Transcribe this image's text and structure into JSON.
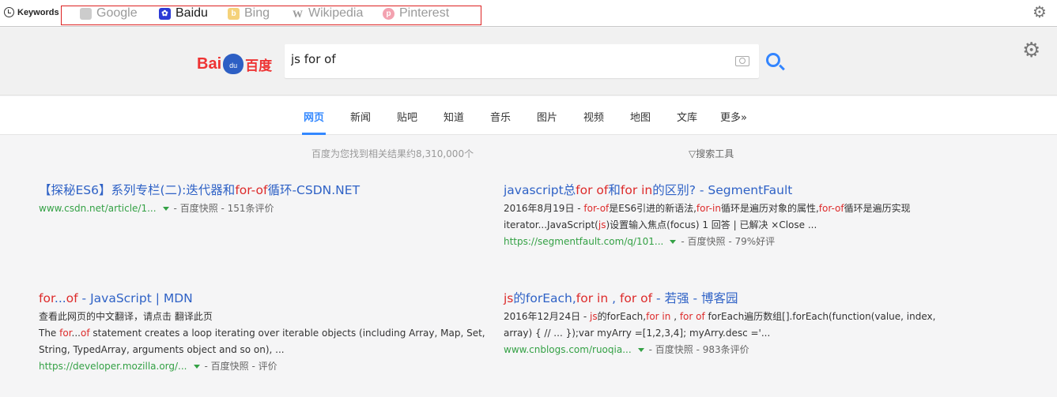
{
  "toolbar": {
    "keywords_label": "Keywords",
    "engines": [
      {
        "label": "Google",
        "icon": "google-icon",
        "color": "#bbbbbb"
      },
      {
        "label": "Baidu",
        "icon": "baidu-paw-icon",
        "color": "#2d3bd6"
      },
      {
        "label": "Bing",
        "icon": "bing-icon",
        "color": "#f5d27a"
      },
      {
        "label": "Wikipedia",
        "icon": "wikipedia-icon",
        "color": "#aaaaaa"
      },
      {
        "label": "Pinterest",
        "icon": "pinterest-icon",
        "color": "#f3a2b0"
      }
    ]
  },
  "header": {
    "logo": {
      "bai": "Bai",
      "du": "du",
      "cn": "百度"
    },
    "search_value": "js for of"
  },
  "tabs": [
    "网页",
    "新闻",
    "贴吧",
    "知道",
    "音乐",
    "图片",
    "视频",
    "地图",
    "文库",
    "更多»"
  ],
  "stats": "百度为您找到相关结果约8,310,000个",
  "tools": "▽搜索工具",
  "results": [
    {
      "title": [
        [
          "【探秘ES6】系列专栏(二):迭代器和",
          ""
        ],
        [
          "for-of",
          "red"
        ],
        [
          "循环-CSDN.NET",
          ""
        ]
      ],
      "url": "www.csdn.net/article/1...",
      "meta": "- 百度快照 - 151条评价"
    },
    {
      "title": [
        [
          "javascript总",
          ""
        ],
        [
          "for of",
          "red"
        ],
        [
          "和",
          ""
        ],
        [
          "for in",
          "red"
        ],
        [
          "的区别? - SegmentFault",
          ""
        ]
      ],
      "line1": [
        [
          "2016年8月19日 - ",
          ""
        ],
        [
          "for-of",
          "red"
        ],
        [
          "是ES6引进的新语法,",
          ""
        ],
        [
          "for-in",
          "red"
        ],
        [
          "循环是遍历对象的属性,",
          ""
        ],
        [
          "for-of",
          "red"
        ],
        [
          "循环是遍历实现",
          ""
        ]
      ],
      "line2": [
        [
          "iterator...JavaScript(",
          ""
        ],
        [
          "js",
          "red"
        ],
        [
          ")设置输入焦点(focus) 1 回答 | 已解决 ×Close ...",
          ""
        ]
      ],
      "url": "https://segmentfault.com/q/101...",
      "meta": "- 百度快照 - 79%好评"
    },
    {
      "title": [
        [
          "for",
          "red"
        ],
        [
          "...",
          ""
        ],
        [
          "of",
          "red"
        ],
        [
          " - JavaScript | MDN",
          ""
        ]
      ],
      "line1": [
        [
          "查看此网页的中文翻译，请点击 翻译此页",
          ""
        ]
      ],
      "line2": [
        [
          "The ",
          ""
        ],
        [
          "for",
          "red"
        ],
        [
          "...",
          ""
        ],
        [
          "of",
          "red"
        ],
        [
          " statement creates a loop iterating over iterable objects (including Array, Map, Set,",
          ""
        ]
      ],
      "line3": [
        [
          "String, TypedArray, arguments object and so on), ...",
          ""
        ]
      ],
      "url": "https://developer.mozilla.org/...",
      "meta": "- 百度快照 - 评价"
    },
    {
      "title": [
        [
          "js",
          "red"
        ],
        [
          "的forEach,",
          ""
        ],
        [
          "for in",
          "red"
        ],
        [
          " , ",
          ""
        ],
        [
          "for of",
          "red"
        ],
        [
          " - 若强 - 博客园",
          ""
        ]
      ],
      "line1": [
        [
          "2016年12月24日 - ",
          ""
        ],
        [
          "js",
          "red"
        ],
        [
          "的forEach,",
          ""
        ],
        [
          "for in",
          "red"
        ],
        [
          " , ",
          ""
        ],
        [
          "for of",
          "red"
        ],
        [
          " forEach遍历数组[].forEach(function(value, index,",
          ""
        ]
      ],
      "line2": [
        [
          "array) { // ... });var myArry =[1,2,3,4]; myArry.desc ='...",
          ""
        ]
      ],
      "url": "www.cnblogs.com/ruoqia...",
      "meta": "- 百度快照 - 983条评价"
    }
  ]
}
